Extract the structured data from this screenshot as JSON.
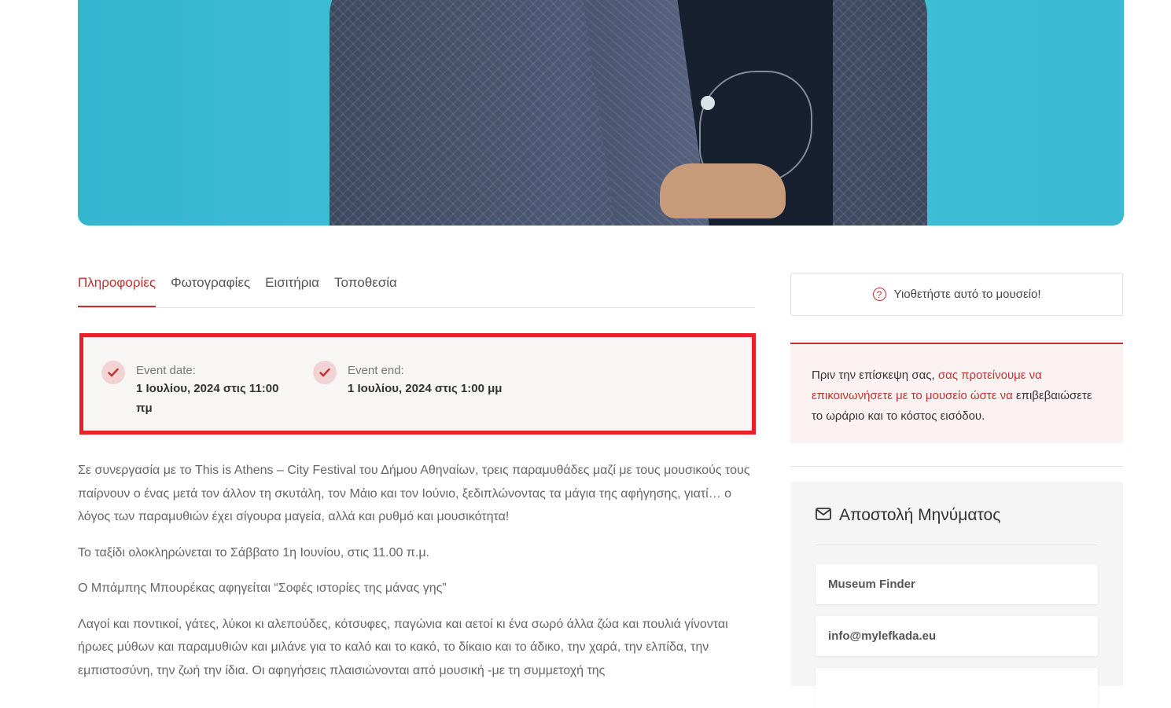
{
  "tabs": [
    {
      "label": "Πληροφορίες",
      "active": true
    },
    {
      "label": "Φωτογραφίες",
      "active": false
    },
    {
      "label": "Εισιτήρια",
      "active": false
    },
    {
      "label": "Τοποθεσία",
      "active": false
    }
  ],
  "event": {
    "start_label": "Event date:",
    "start_value": "1 Ιουλίου, 2024 στις 11:00 πμ",
    "end_label": "Event end:",
    "end_value": "1 Ιουλίου, 2024 στις 1:00 μμ"
  },
  "description": [
    "Σε συνεργασία με το This is Athens – City Festival του Δήμου Αθηναίων, τρεις παραμυθάδες μαζί με τους μουσικούς τους παίρνουν ο ένας μετά τον άλλον τη σκυτάλη, τον Μάιο και τον Ιούνιο, ξεδιπλώνοντας τα μάγια της αφήγησης, γιατί… ο λόγος των παραμυθιών έχει σίγουρα μαγεία, αλλά και ρυθμό και μουσικότητα!",
    "Το ταξίδι ολοκληρώνεται το Σάββατο 1η Ιουνίου, στις 11.00 π.μ.",
    "Ο Μπάμπης Μπουρέκας αφηγείται “Σοφές ιστορίες της μάνας γης”",
    "Λαγοί και ποντικοί, γάτες, λύκοι κι αλεπούδες, κότσυφες, παγώνια και αετοί κι ένα σωρό άλλα ζώα και πουλιά γίνονται ήρωες μύθων και παραμυθιών και μιλάνε για το καλό και το κακό, το δίκαιο και το άδικο, την χαρά, την ελπίδα, την εμπιστοσύνη, την ζωή την ίδια. Οι αφηγήσεις πλαισιώνονται από μουσική -με τη συμμετοχή της"
  ],
  "sidebar": {
    "adopt_label": "Υιοθετήστε αυτό το μουσείο!",
    "notice_pre": "Πριν την επίσκεψη σας, ",
    "notice_link": "σας προτείνουμε να επικοινωνήσετε με το μουσείο ώστε να",
    "notice_post": " επιβεβαιώσετε το ωράριο και το κόστος εισόδου.",
    "contact_title": "Αποστολή Μηνύματος",
    "contact_name": "Museum Finder",
    "contact_email": "info@mylefkada.eu"
  },
  "icons": {
    "check": "check-icon",
    "question": "question-circle-icon",
    "envelope": "envelope-icon"
  },
  "colors": {
    "accent": "#c0322f",
    "highlight_border": "#e8202a"
  }
}
